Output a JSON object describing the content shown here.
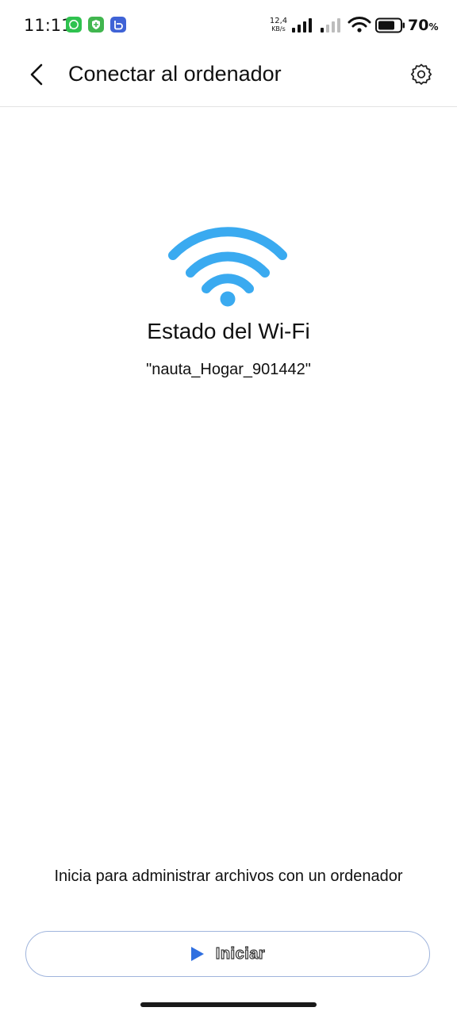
{
  "status_bar": {
    "time": "11:11",
    "net_speed_value": "12,4",
    "net_speed_unit": "KB/s",
    "battery_percent": "70",
    "percent_sign": "%"
  },
  "app_bar": {
    "title": "Conectar al ordenador"
  },
  "main": {
    "wifi_heading": "Estado del Wi-Fi",
    "wifi_ssid": "\"nauta_Hogar_901442\"",
    "accent_color": "#3aaaf0"
  },
  "footer": {
    "hint": "Inicia para administrar archivos con un ordenador",
    "start_label": "Iniciar",
    "start_icon_color": "#2f6fe0"
  }
}
